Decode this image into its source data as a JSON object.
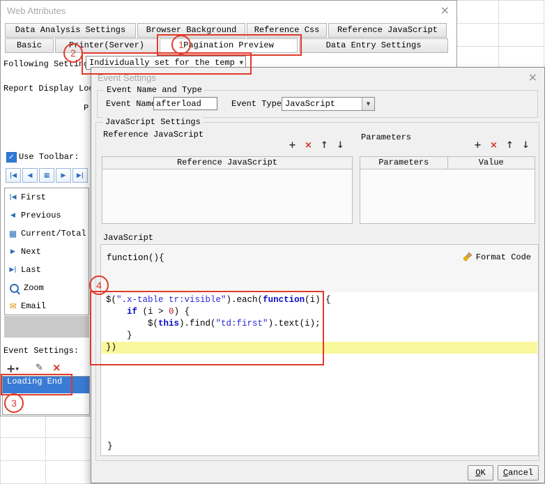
{
  "colors": {
    "annotation_red": "#e03a2a",
    "selection_blue": "#3a7bd5",
    "icon_blue": "#2d6fb8",
    "email_orange": "#d98e00",
    "highlight_yellow": "#faf89c",
    "keyword_blue": "#0a0ac8",
    "string_blue": "#2828d8"
  },
  "web_attributes": {
    "title": "Web Attributes",
    "close_glyph": "×",
    "tabs_row1": [
      {
        "label": "Data Analysis Settings"
      },
      {
        "label": "Browser Background"
      },
      {
        "label": "Reference Css"
      },
      {
        "label": "Reference JavaScript"
      }
    ],
    "tabs_row2": [
      {
        "label": "Basic"
      },
      {
        "label": "Printer(Server)"
      },
      {
        "label": "Pagination Preview",
        "selected": true
      },
      {
        "label": "Data Entry Settings"
      }
    ],
    "following_settings_label": "Following Settings",
    "template_dropdown_value": "Individually set for the template",
    "dropdown_arrow_glyph": "▼",
    "report_display_label": "Report Display Locat",
    "partial_label": "P",
    "use_toolbar_label": "Use Toolbar:",
    "checkbox_check_glyph": "✓",
    "nav_buttons": [
      {
        "icon": "first-icon",
        "glyph": "|◀"
      },
      {
        "icon": "previous-icon",
        "glyph": "◀"
      },
      {
        "icon": "page-display-icon",
        "glyph": "▦"
      },
      {
        "icon": "next-icon",
        "glyph": "▶"
      },
      {
        "icon": "last-icon",
        "glyph": "▶|"
      }
    ],
    "toolbar_items": [
      {
        "icon": "first-icon",
        "glyph": "|◀",
        "label": "First"
      },
      {
        "icon": "previous-icon",
        "glyph": "◀",
        "label": "Previous"
      },
      {
        "icon": "page-display-icon",
        "glyph": "▦",
        "label": "Current/Total"
      },
      {
        "icon": "next-icon",
        "glyph": "▶",
        "label": "Next"
      },
      {
        "icon": "last-icon",
        "glyph": "▶|",
        "label": "Last"
      },
      {
        "icon": "zoom-icon",
        "glyph": "",
        "label": "Zoom"
      },
      {
        "icon": "email-icon",
        "glyph": "✉",
        "label": "Email"
      }
    ],
    "event_settings_label": "Event Settings:",
    "add_event_glyph": "+",
    "add_event_arrow_glyph": "▼",
    "edit_event_glyph": "✎",
    "delete_event_glyph": "×",
    "event_list": [
      {
        "label": "Loading End",
        "selected": true
      }
    ]
  },
  "event_dialog": {
    "title": "Event Settings",
    "close_glyph": "×",
    "group_event_title": "Event Name and Type",
    "event_name_label": "Event Name:",
    "event_name_value": "afterload",
    "event_type_label": "Event Type:",
    "event_type_value": "JavaScript",
    "dropdown_arrow_glyph": "▼",
    "group_js_title": "JavaScript Settings",
    "reference_js_label": "Reference JavaScript",
    "parameters_label": "Parameters",
    "list_buttons": {
      "add": "+",
      "remove": "×",
      "up": "↑",
      "down": "↓"
    },
    "ref_table_header": "Reference JavaScript",
    "param_table_headers": [
      "Parameters",
      "Value"
    ],
    "javascript_label": "JavaScript",
    "function_open": "function(){",
    "function_close": "}",
    "format_code_label": "Format Code",
    "code_lines": [
      [
        {
          "t": "$(",
          "c": "p"
        },
        {
          "t": "\".x-table tr:visible\"",
          "c": "s"
        },
        {
          "t": ").each(",
          "c": "p"
        },
        {
          "t": "function",
          "c": "k"
        },
        {
          "t": "(i) {",
          "c": "p"
        }
      ],
      [
        {
          "t": "    ",
          "c": "p"
        },
        {
          "t": "if",
          "c": "k"
        },
        {
          "t": " (i > ",
          "c": "p"
        },
        {
          "t": "0",
          "c": "n"
        },
        {
          "t": ") {",
          "c": "p"
        }
      ],
      [
        {
          "t": "        $(",
          "c": "p"
        },
        {
          "t": "this",
          "c": "k"
        },
        {
          "t": ").find(",
          "c": "p"
        },
        {
          "t": "\"td:first\"",
          "c": "s"
        },
        {
          "t": ").text(i);",
          "c": "p"
        }
      ],
      [
        {
          "t": "    }",
          "c": "p"
        }
      ],
      [
        {
          "t": "})",
          "c": "p"
        }
      ]
    ],
    "ok_label": "OK",
    "cancel_label": "Cancel"
  },
  "annotations": {
    "labels": [
      "1",
      "2",
      "3",
      "4"
    ]
  }
}
